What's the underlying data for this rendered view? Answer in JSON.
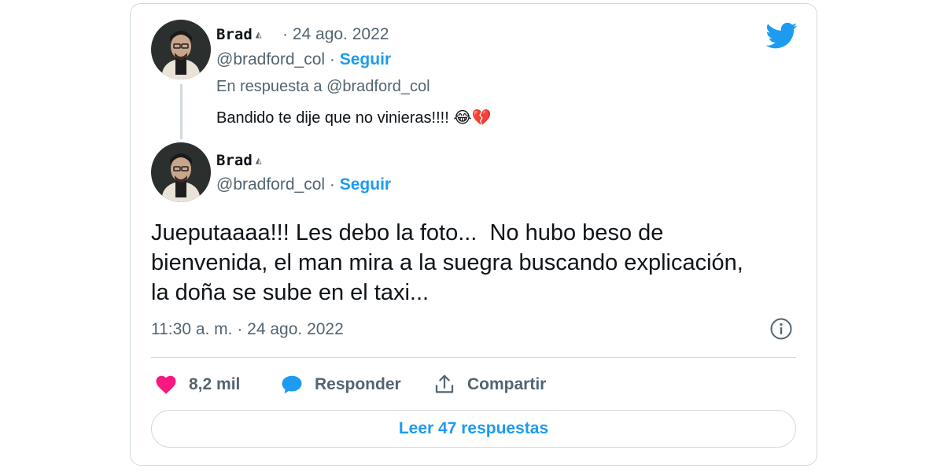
{
  "reply_tweet": {
    "name": "Brad",
    "date": "· 24 ago. 2022",
    "handle": "@bradford_col",
    "follow_label": "Seguir",
    "reply_to": "En respuesta a @bradford_col",
    "text": "Bandido te dije que no vinieras!!!! 😂💔"
  },
  "main_tweet": {
    "name": "Brad",
    "handle": "@bradford_col",
    "follow_label": "Seguir",
    "text": "Jueputaaaa!!! Les debo la foto...  No hubo beso de\nbienvenida, el man mira a la suegra buscando explicación,\nla doña se sube en el taxi...",
    "timestamp": "11:30 a. m. · 24 ago. 2022"
  },
  "actions": {
    "likes": "8,2 mil",
    "reply_label": "Responder",
    "share_label": "Compartir"
  },
  "read_replies_label": "Leer 47 respuestas",
  "icons": {
    "logo": "twitter-bird-icon",
    "like": "heart-icon",
    "reply": "speech-bubble-icon",
    "share": "share-upload-icon",
    "info": "info-icon"
  },
  "colors": {
    "accent": "#1d9bf0",
    "like": "#f91880",
    "muted": "#536471",
    "border": "#cfd9de"
  }
}
